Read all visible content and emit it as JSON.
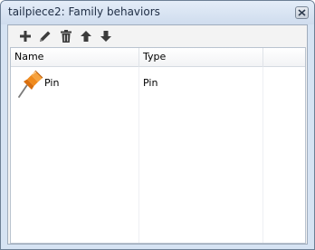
{
  "window": {
    "title": "tailpiece2: Family behaviors"
  },
  "toolbar": {
    "buttons": [
      {
        "name": "add",
        "icon": "plus-icon"
      },
      {
        "name": "edit",
        "icon": "pencil-icon"
      },
      {
        "name": "delete",
        "icon": "trash-icon"
      },
      {
        "name": "move-up",
        "icon": "arrow-up-icon"
      },
      {
        "name": "move-down",
        "icon": "arrow-down-icon"
      }
    ]
  },
  "table": {
    "columns": [
      "Name",
      "Type"
    ],
    "rows": [
      {
        "icon": "pin-icon",
        "name": "Pin",
        "type": "Pin"
      }
    ]
  },
  "colors": {
    "pin_orange": "#f08a1c",
    "toolbar_icon": "#3c3c3c"
  }
}
